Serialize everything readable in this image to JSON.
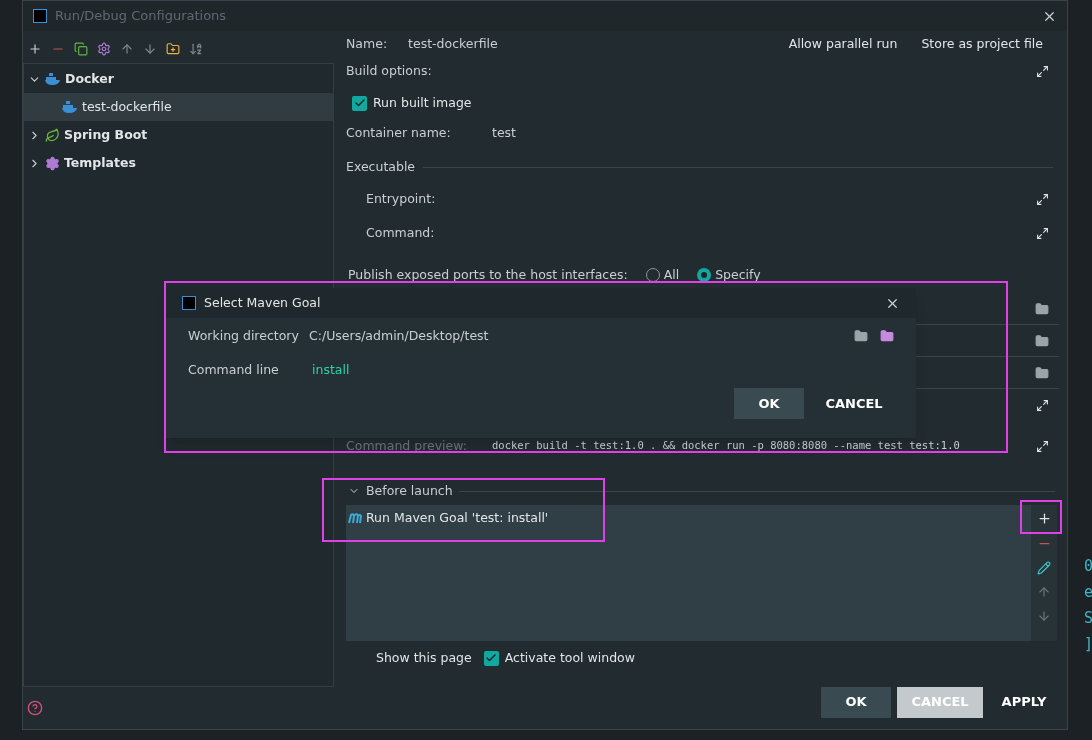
{
  "window": {
    "title": "Run/Debug Configurations"
  },
  "tree": [
    {
      "label": "Docker",
      "kind": "docker",
      "expanded": true,
      "selected": false,
      "children": [
        {
          "label": "test-dockerfile",
          "kind": "docker",
          "selected": true
        }
      ]
    },
    {
      "label": "Spring Boot",
      "kind": "spring",
      "expanded": false,
      "selected": false
    },
    {
      "label": "Templates",
      "kind": "gear",
      "expanded": false,
      "selected": false
    }
  ],
  "form": {
    "name_label": "Name:",
    "name_value": "test-dockerfile",
    "allow_parallel": "Allow parallel run",
    "store_as_project": "Store as project file",
    "build_options": "Build options:",
    "run_built_image": {
      "label": "Run built image",
      "checked": true
    },
    "container_label": "Container name:",
    "container_value": "test",
    "executable": "Executable",
    "entrypoint": "Entrypoint:",
    "command": "Command:",
    "publish": {
      "label": "Publish exposed ports to the host interfaces:",
      "options": [
        {
          "label": "All",
          "selected": false
        },
        {
          "label": "Specify",
          "selected": true
        }
      ]
    },
    "preview_label": "Command preview:",
    "preview_value": "docker build -t test:1.0 . && docker run -p 8080:8080 --name test test:1.0"
  },
  "before_launch": {
    "title": "Before launch",
    "expanded": true,
    "tasks": [
      {
        "label": "Run Maven Goal 'test: install'"
      }
    ],
    "show_this_page": "Show this page",
    "activate_tool_window": {
      "label": "Activate tool window",
      "checked": true
    }
  },
  "buttons": [
    {
      "label": "OK",
      "kind": "default"
    },
    {
      "label": "CANCEL",
      "kind": "primary"
    },
    {
      "label": "APPLY",
      "kind": "plain"
    }
  ],
  "maven_dialog": {
    "title": "Select Maven Goal",
    "working_dir_label": "Working directory",
    "working_dir": "C:/Users/admin/Desktop/test",
    "command_label": "Command line",
    "command": "install",
    "buttons": [
      {
        "label": "OK",
        "kind": "default"
      },
      {
        "label": "CANCEL",
        "kind": "plain"
      }
    ]
  },
  "editor_fragments": [
    "0",
    "e",
    "S",
    "]"
  ]
}
